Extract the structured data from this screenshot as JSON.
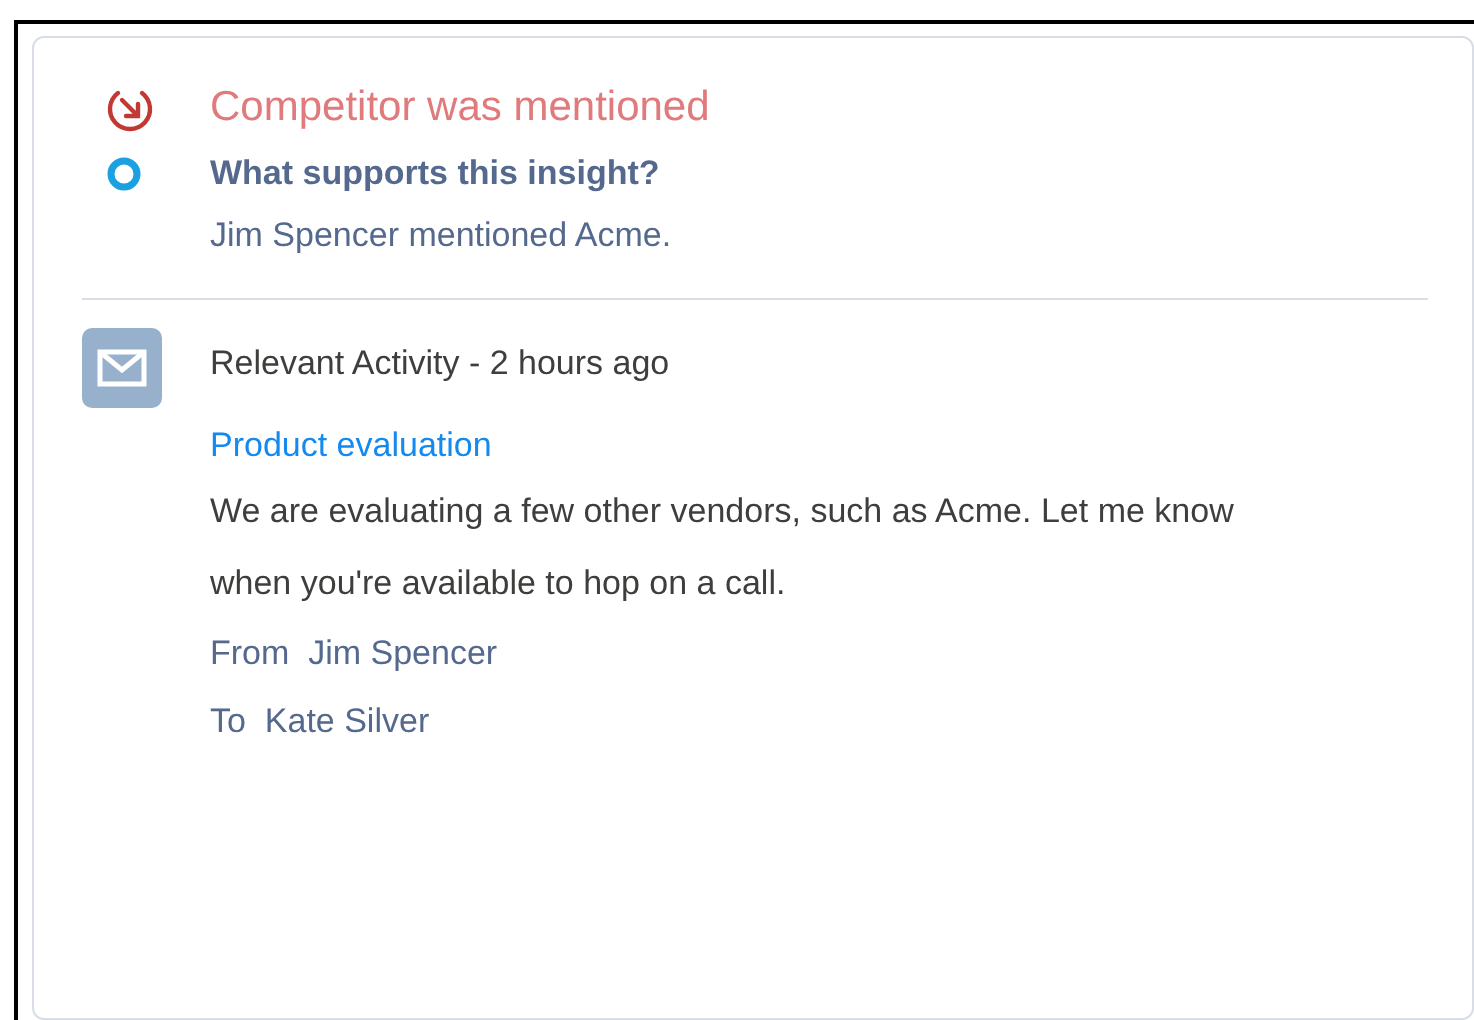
{
  "insight": {
    "title": "Competitor was mentioned",
    "question": "What supports this insight?",
    "detail": "Jim Spencer mentioned Acme."
  },
  "activity": {
    "heading": "Relevant Activity - 2 hours ago",
    "subject": "Product evaluation",
    "body": "We are evaluating a few other vendors, such as Acme. Let me know when you're available to hop on a call.",
    "from": "From  Jim Spencer",
    "to": "To  Kate Silver"
  }
}
